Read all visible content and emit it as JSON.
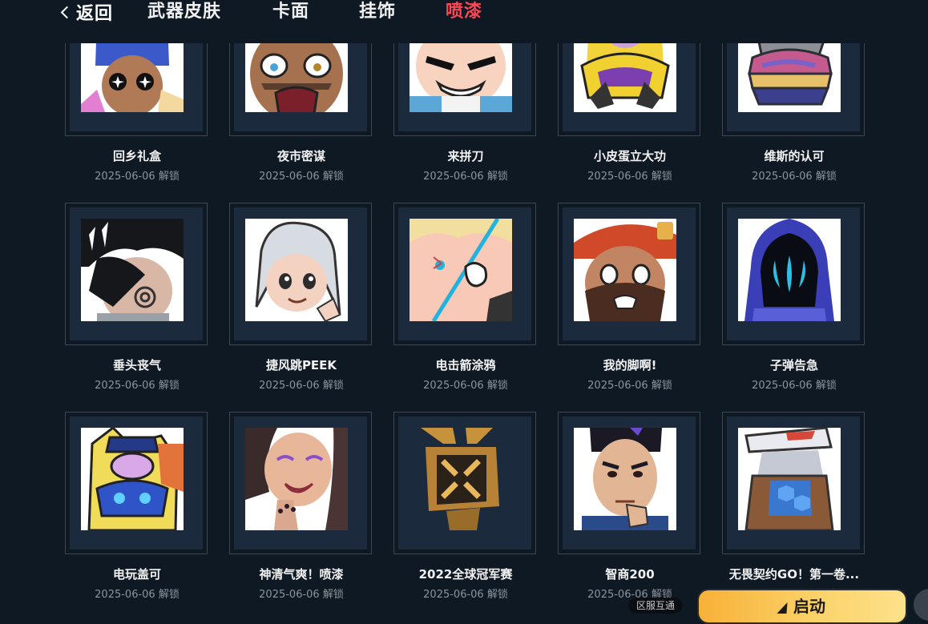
{
  "nav": {
    "back_label": "返回",
    "tabs": [
      {
        "label": "武器皮肤",
        "active": false
      },
      {
        "label": "卡面",
        "active": false
      },
      {
        "label": "挂饰",
        "active": false
      },
      {
        "label": "喷漆",
        "active": true
      }
    ],
    "active_color": "#ff4655"
  },
  "items": [
    {
      "name": "回乡礼盒",
      "date": "2025-06-06 解锁"
    },
    {
      "name": "夜市密谋",
      "date": "2025-06-06 解锁"
    },
    {
      "name": "来拼刀",
      "date": "2025-06-06 解锁"
    },
    {
      "name": "小皮蛋立大功",
      "date": "2025-06-06 解锁"
    },
    {
      "name": "维斯的认可",
      "date": "2025-06-06 解锁"
    },
    {
      "name": "垂头丧气",
      "date": "2025-06-06 解锁"
    },
    {
      "name": "捷风跳PEEK",
      "date": "2025-06-06 解锁"
    },
    {
      "name": "电击箭涂鸦",
      "date": "2025-06-06 解锁"
    },
    {
      "name": "我的脚啊!",
      "date": "2025-06-06 解锁"
    },
    {
      "name": "子弹告急",
      "date": "2025-06-06 解锁"
    },
    {
      "name": "电玩盖可",
      "date": "2025-06-06 解锁"
    },
    {
      "name": "神清气爽！喷漆",
      "date": "2025-06-06 解锁"
    },
    {
      "name": "2022全球冠军赛",
      "date": "2025-06-06 解锁"
    },
    {
      "name": "智商200",
      "date": "2025-06-06 解锁"
    },
    {
      "name": "无畏契约GO！第一卷...",
      "date": "2025-06-06 解锁"
    }
  ],
  "footer": {
    "region_badge": "区服互通",
    "launch_label": "启动"
  }
}
